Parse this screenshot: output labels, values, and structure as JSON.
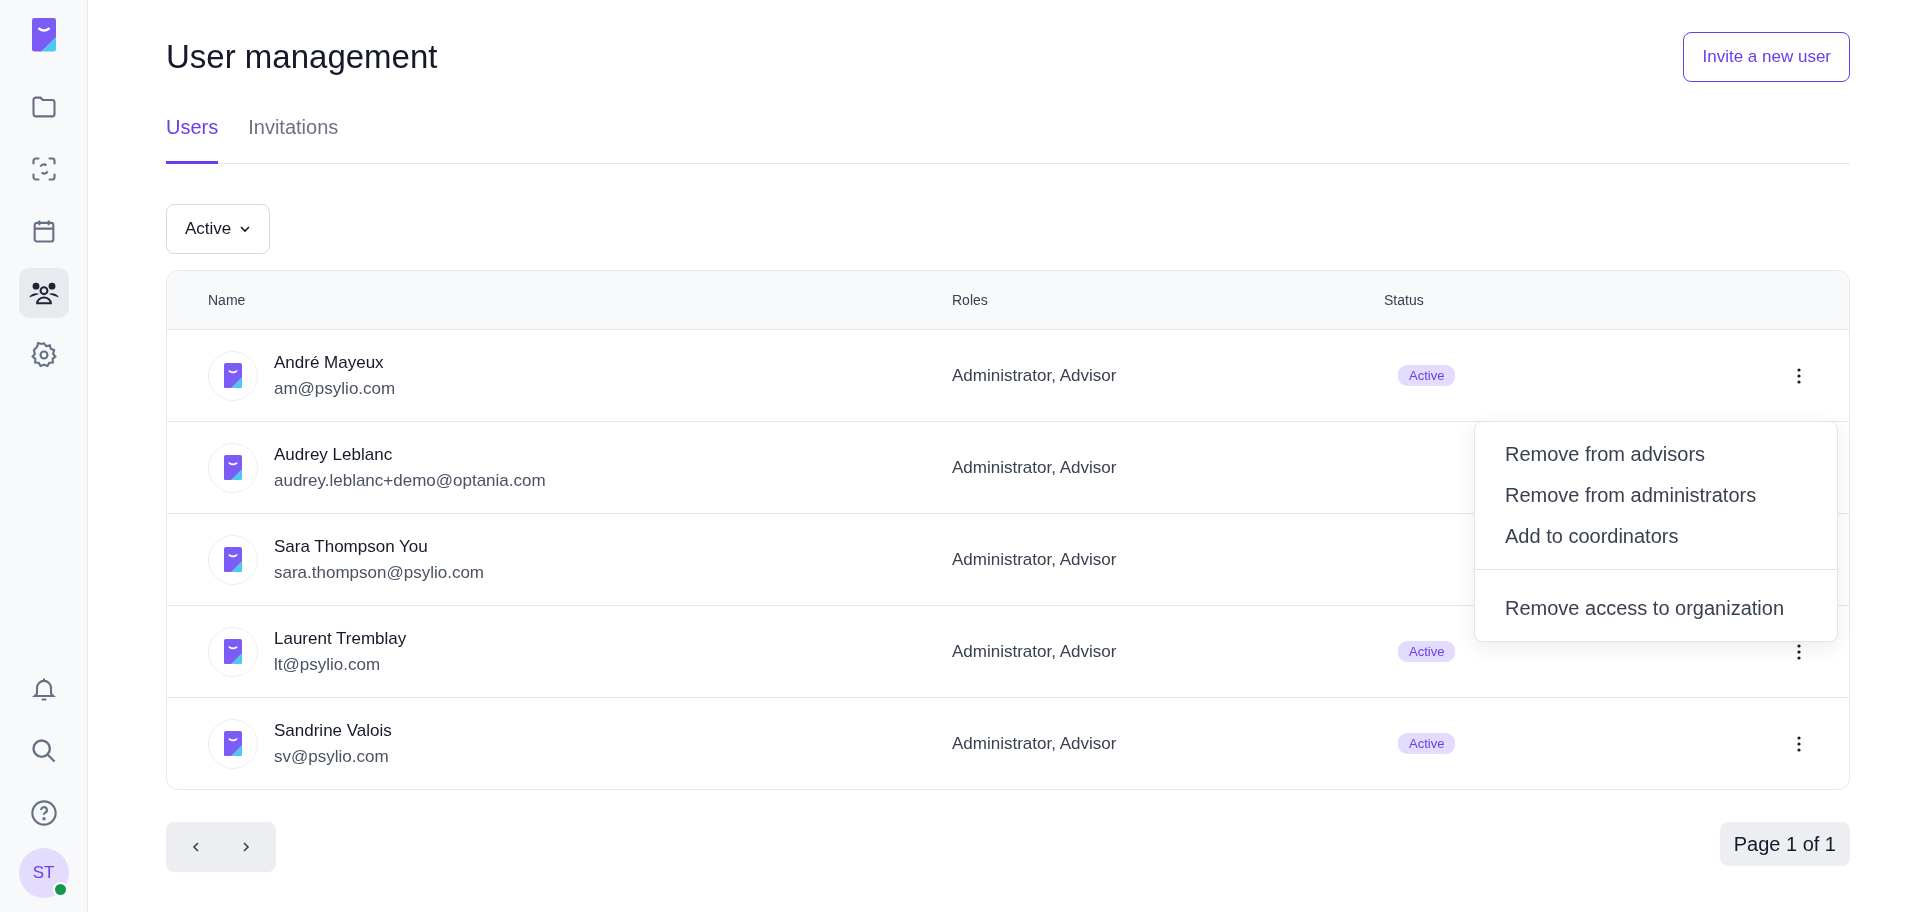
{
  "sidebar": {
    "nav": [
      {
        "kind": "folder",
        "selected": false
      },
      {
        "kind": "scan",
        "selected": false
      },
      {
        "kind": "calendar",
        "selected": false
      },
      {
        "kind": "users",
        "selected": true
      },
      {
        "kind": "settings",
        "selected": false
      }
    ],
    "bottom": [
      {
        "kind": "bell"
      },
      {
        "kind": "search"
      },
      {
        "kind": "help"
      }
    ],
    "avatar": {
      "initials": "ST",
      "online": true
    }
  },
  "header": {
    "title": "User management",
    "action": "Invite a new user"
  },
  "tabs": [
    {
      "label": "Users",
      "selected": true
    },
    {
      "label": "Invitations",
      "selected": false
    }
  ],
  "filter": {
    "label": "Active"
  },
  "table": {
    "columns": [
      "Name",
      "Roles",
      "Status"
    ],
    "rows": [
      {
        "name": "André Mayeux",
        "email": "am@psylio.com",
        "roles": "Administrator, Advisor",
        "status": "Active",
        "menu": {
          "sections": [
            [
              "Remove from advisors",
              "Remove from administrators",
              "Add to coordinators"
            ],
            [
              "Remove access to organization"
            ]
          ]
        }
      },
      {
        "name": "Audrey Leblanc",
        "email": "audrey.leblanc+demo@optania.com",
        "roles": "Administrator, Advisor"
      },
      {
        "name": "Sara Thompson You",
        "email": "sara.thompson@psylio.com",
        "roles": "Administrator, Advisor"
      },
      {
        "name": "Laurent Tremblay",
        "email": "lt@psylio.com",
        "roles": "Administrator, Advisor",
        "status": "Active"
      },
      {
        "name": "Sandrine Valois",
        "email": "sv@psylio.com",
        "roles": "Administrator, Advisor",
        "status": "Active"
      }
    ]
  },
  "pagination": {
    "page": "Page 1 of 1"
  }
}
